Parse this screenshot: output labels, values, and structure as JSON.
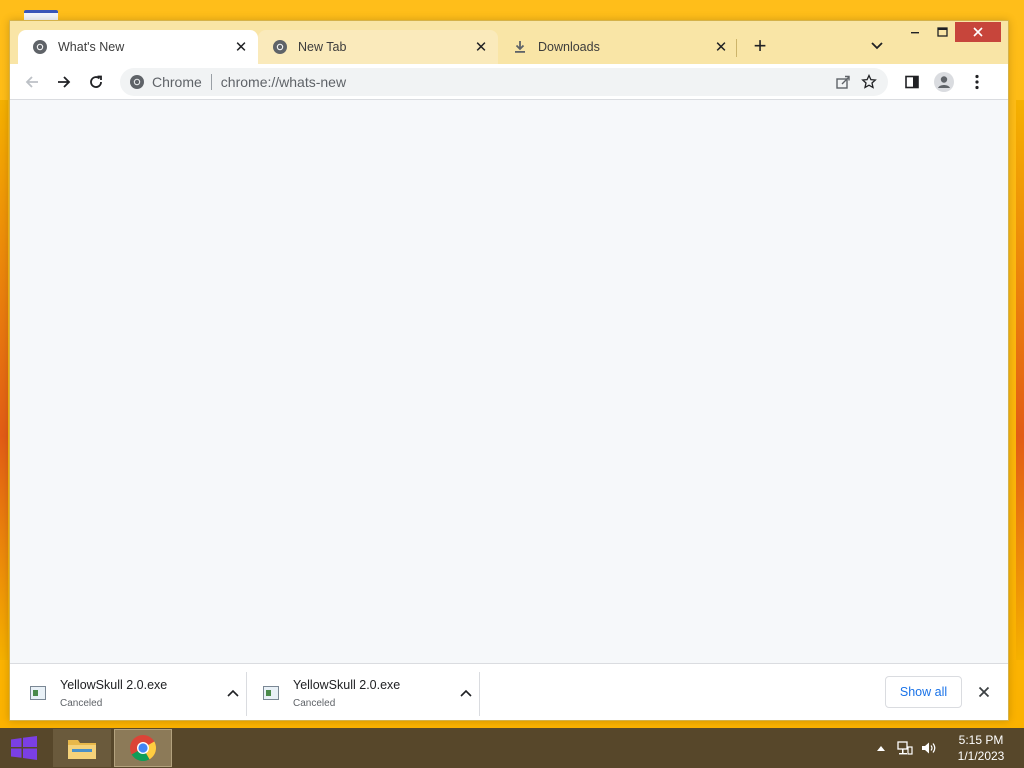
{
  "window": {
    "tabs": [
      {
        "title": "What's New",
        "icon": "chrome-icon",
        "active": true
      },
      {
        "title": "New Tab",
        "icon": "chrome-icon",
        "active": false
      },
      {
        "title": "Downloads",
        "icon": "download-icon",
        "active": false
      }
    ],
    "new_tab_label": "+"
  },
  "toolbar": {
    "site_chip": "Chrome",
    "url": "chrome://whats-new"
  },
  "downloads": {
    "items": [
      {
        "filename": "YellowSkull 2.0.exe",
        "status": "Canceled"
      },
      {
        "filename": "YellowSkull 2.0.exe",
        "status": "Canceled"
      }
    ],
    "show_all_label": "Show all"
  },
  "taskbar": {
    "clock_time": "5:15 PM",
    "clock_date": "1/1/2023"
  },
  "colors": {
    "desktop": "#fbb200",
    "tabstrip": "#f9e5a6",
    "accent": "#1a73e8",
    "taskbar": "#57472a",
    "close_button": "#c7453b"
  }
}
